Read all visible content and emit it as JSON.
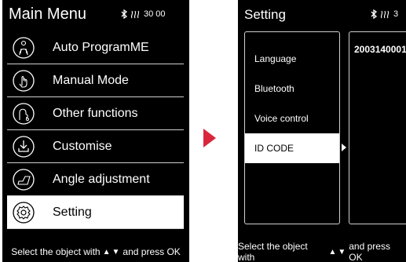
{
  "left_screen": {
    "title": "Main Menu",
    "status_text": "30 00",
    "menu": [
      {
        "label": "Auto ProgramME",
        "icon": "auto-program-icon"
      },
      {
        "label": "Manual Mode",
        "icon": "manual-mode-icon"
      },
      {
        "label": "Other functions",
        "icon": "other-functions-icon"
      },
      {
        "label": "Customise",
        "icon": "customise-icon"
      },
      {
        "label": "Angle adjustment",
        "icon": "angle-adjustment-icon"
      },
      {
        "label": "Setting",
        "icon": "setting-gear-icon",
        "selected": true
      }
    ],
    "footer": {
      "pre": "Select the object with",
      "post": "and press OK"
    }
  },
  "right_screen": {
    "title": "Setting",
    "status_text": "3",
    "options": [
      {
        "label": "Language"
      },
      {
        "label": "Bluetooth"
      },
      {
        "label": "Voice control"
      },
      {
        "label": "ID CODE",
        "selected": true
      }
    ],
    "id_value": "2003140001",
    "footer": {
      "pre": "Select the object with",
      "post": "and press OK"
    }
  },
  "colors": {
    "screen_bg": "#000000",
    "arrow": "#d9263c",
    "highlight": "#ffffff"
  }
}
